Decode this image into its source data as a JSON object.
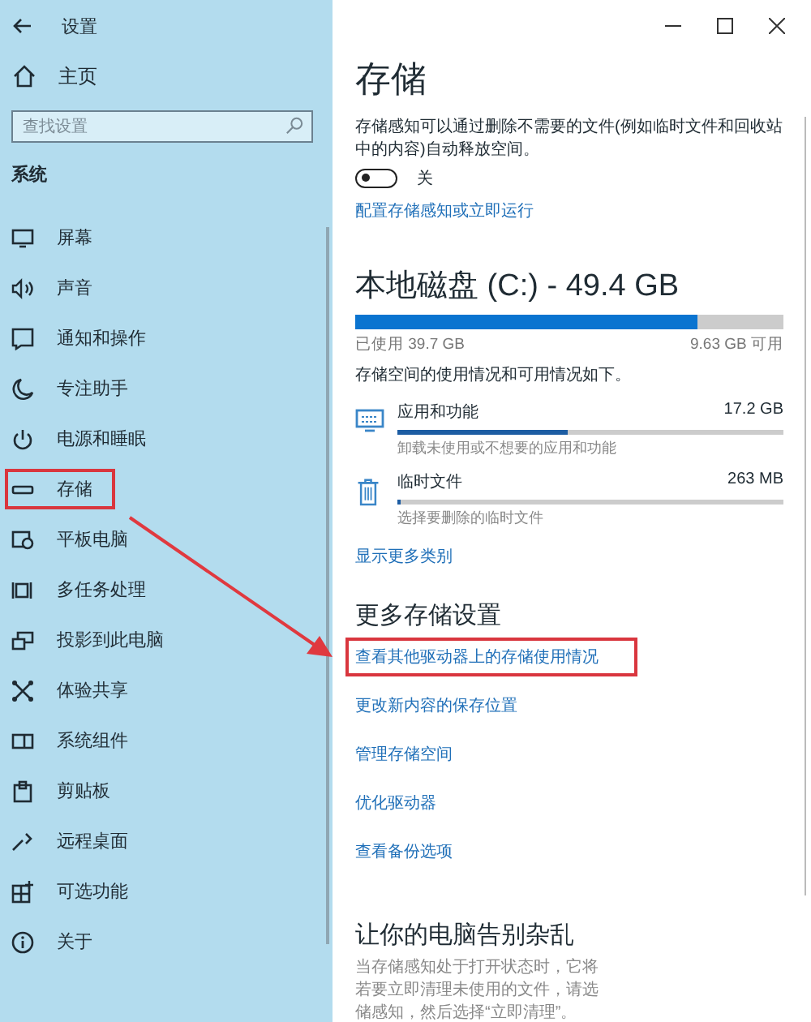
{
  "window": {
    "title": "设置"
  },
  "sidebar": {
    "home": "主页",
    "search_placeholder": "查找设置",
    "section": "系统",
    "items": [
      {
        "label": "屏幕",
        "highlighted": false
      },
      {
        "label": "声音",
        "highlighted": false
      },
      {
        "label": "通知和操作",
        "highlighted": false
      },
      {
        "label": "专注助手",
        "highlighted": false
      },
      {
        "label": "电源和睡眠",
        "highlighted": false
      },
      {
        "label": "存储",
        "highlighted": true
      },
      {
        "label": "平板电脑",
        "highlighted": false
      },
      {
        "label": "多任务处理",
        "highlighted": false
      },
      {
        "label": "投影到此电脑",
        "highlighted": false
      },
      {
        "label": "体验共享",
        "highlighted": false
      },
      {
        "label": "系统组件",
        "highlighted": false
      },
      {
        "label": "剪贴板",
        "highlighted": false
      },
      {
        "label": "远程桌面",
        "highlighted": false
      },
      {
        "label": "可选功能",
        "highlighted": false
      },
      {
        "label": "关于",
        "highlighted": false
      }
    ]
  },
  "main": {
    "title": "存储",
    "storage_sense": {
      "description": "存储感知可以通过删除不需要的文件(例如临时文件和回收站中的内容)自动释放空间。",
      "toggle": {
        "on": false,
        "label": "关"
      },
      "link": "配置存储感知或立即运行"
    },
    "disk": {
      "title": "本地磁盘 (C:) - 49.4 GB",
      "level": 0.8,
      "used": "已使用 39.7 GB",
      "free": "9.63 GB 可用",
      "caption": "存储空间的使用情况和可用情况如下。",
      "categories": [
        {
          "kind": "apps",
          "name": "应用和功能",
          "size": "17.2 GB",
          "level": 0.44,
          "hint": "卸载未使用或不想要的应用和功能"
        },
        {
          "kind": "temp",
          "name": "临时文件",
          "size": "263 MB",
          "level": 0.01,
          "hint": "选择要删除的临时文件"
        }
      ],
      "more_link": "显示更多类别"
    },
    "more_settings": {
      "heading": "更多存储设置",
      "links": [
        {
          "label": "查看其他驱动器上的存储使用情况",
          "highlighted": true
        },
        {
          "label": "更改新内容的保存位置",
          "highlighted": false
        },
        {
          "label": "管理存储空间",
          "highlighted": false
        },
        {
          "label": "优化驱动器",
          "highlighted": false
        },
        {
          "label": "查看备份选项",
          "highlighted": false
        }
      ]
    },
    "cleanup": {
      "heading": "让你的电脑告别杂乱",
      "lines": [
        "当存储感知处于打开状态时，它将",
        "若要立即清理未使用的文件，请选",
        "储感知，然后选择“立即清理”。"
      ]
    }
  }
}
